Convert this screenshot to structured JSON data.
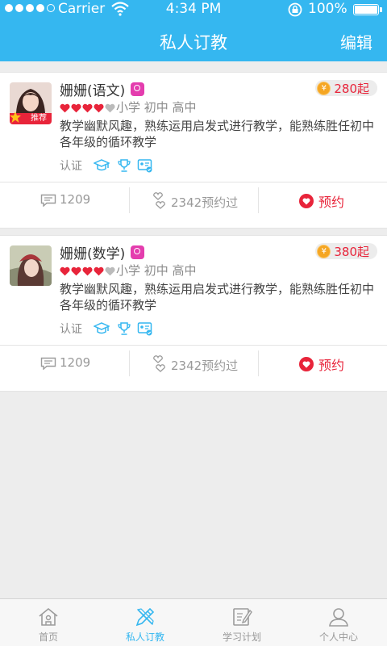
{
  "status_bar": {
    "carrier": "Carrier",
    "time": "4:34 PM",
    "battery": "100%"
  },
  "nav": {
    "title": "私人订教",
    "edit_label": "编辑"
  },
  "teachers": [
    {
      "name": "姗姗(语文)",
      "recommend_label": "推荐",
      "coin_symbol": "¥",
      "price": "280起",
      "rating": 4,
      "levels": "小学 初中 高中",
      "description": "教学幽默风趣，熟练运用启发式进行教学，能熟练胜任初中各年级的循环教学",
      "certify_label": "认证",
      "comments": "1209",
      "booked": "2342预约过",
      "reserve_label": "预约"
    },
    {
      "name": "姗姗(数学)",
      "coin_symbol": "¥",
      "price": "380起",
      "rating": 4,
      "levels": "小学 初中 高中",
      "description": "教学幽默风趣，熟练运用启发式进行教学，能熟练胜任初中各年级的循环教学",
      "certify_label": "认证",
      "comments": "1209",
      "booked": "2342预约过",
      "reserve_label": "预约"
    }
  ],
  "tab_bar": {
    "tabs": [
      {
        "label": "首页",
        "icon": "home-icon"
      },
      {
        "label": "私人订教",
        "icon": "pencil-ruler-icon"
      },
      {
        "label": "学习计划",
        "icon": "notepad-icon"
      },
      {
        "label": "个人中心",
        "icon": "person-icon"
      }
    ],
    "active_index": 1
  },
  "colors": {
    "primary": "#35b7f0",
    "accent_red": "#e8243a",
    "coin": "#f5a623",
    "female_badge": "#e43dae"
  }
}
